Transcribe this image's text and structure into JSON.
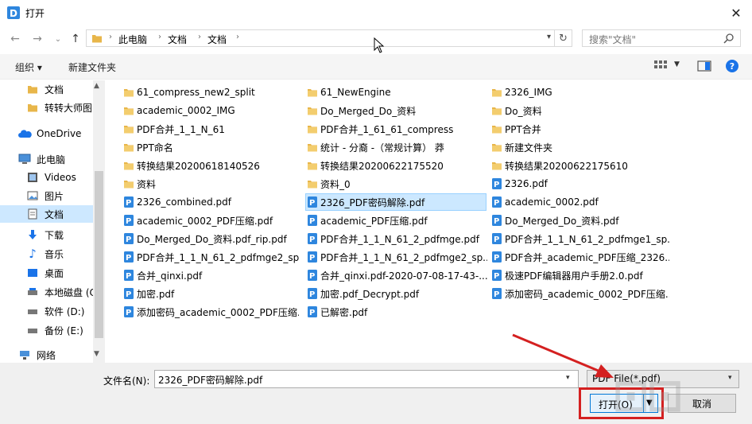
{
  "window": {
    "title": "打开"
  },
  "address": {
    "breadcrumb": [
      "此电脑",
      "文档",
      "文档"
    ]
  },
  "search": {
    "placeholder": "搜索\"文档\""
  },
  "toolbar": {
    "organize": "组织 ▾",
    "new_folder": "新建文件夹"
  },
  "sidebar": {
    "items": [
      {
        "label": "文档",
        "icon": "folder-icon"
      },
      {
        "label": "转转大师图",
        "icon": "folder-icon"
      },
      {
        "label": "OneDrive",
        "icon": "cloud-icon"
      },
      {
        "label": "此电脑",
        "icon": "computer-icon"
      },
      {
        "label": "Videos",
        "icon": "video-icon"
      },
      {
        "label": "图片",
        "icon": "picture-icon"
      },
      {
        "label": "文档",
        "icon": "document-icon"
      },
      {
        "label": "下载",
        "icon": "download-icon"
      },
      {
        "label": "音乐",
        "icon": "music-icon"
      },
      {
        "label": "桌面",
        "icon": "desktop-icon"
      },
      {
        "label": "本地磁盘 (C",
        "icon": "drive-icon"
      },
      {
        "label": "软件 (D:)",
        "icon": "drive-icon"
      },
      {
        "label": "备份 (E:)",
        "icon": "drive-icon"
      },
      {
        "label": "网络",
        "icon": "network-icon"
      }
    ]
  },
  "files": [
    {
      "name": "61_compress_new2_split",
      "type": "folder"
    },
    {
      "name": "academic_0002_IMG",
      "type": "folder"
    },
    {
      "name": "PDF合并_1_1_N_61",
      "type": "folder"
    },
    {
      "name": "PPT命名",
      "type": "folder"
    },
    {
      "name": "转换结果20200618140526",
      "type": "folder"
    },
    {
      "name": "资料",
      "type": "folder"
    },
    {
      "name": "2326_combined.pdf",
      "type": "pdf"
    },
    {
      "name": "academic_0002_PDF压缩.pdf",
      "type": "pdf"
    },
    {
      "name": "Do_Merged_Do_资料.pdf_rip.pdf",
      "type": "pdf"
    },
    {
      "name": "PDF合并_1_1_N_61_2_pdfmge2_sp...",
      "type": "pdf"
    },
    {
      "name": "合并_qinxi.pdf",
      "type": "pdf"
    },
    {
      "name": "加密.pdf",
      "type": "pdf"
    },
    {
      "name": "添加密码_academic_0002_PDF压缩...",
      "type": "pdf"
    },
    {
      "name": "61_NewEngine",
      "type": "folder"
    },
    {
      "name": "Do_Merged_Do_资料",
      "type": "folder"
    },
    {
      "name": "PDF合并_1_61_61_compress",
      "type": "folder"
    },
    {
      "name": "统计 - 分裔 -（常规计算） 莽",
      "type": "folder"
    },
    {
      "name": "转换结果20200622175520",
      "type": "folder"
    },
    {
      "name": "资料_0",
      "type": "folder"
    },
    {
      "name": "2326_PDF密码解除.pdf",
      "type": "pdf",
      "selected": true
    },
    {
      "name": "academic_PDF压缩.pdf",
      "type": "pdf"
    },
    {
      "name": "PDF合并_1_1_N_61_2_pdfmge.pdf",
      "type": "pdf"
    },
    {
      "name": "PDF合并_1_1_N_61_2_pdfmge2_sp...",
      "type": "pdf"
    },
    {
      "name": "合并_qinxi.pdf-2020-07-08-17-43-...",
      "type": "pdf"
    },
    {
      "name": "加密.pdf_Decrypt.pdf",
      "type": "pdf"
    },
    {
      "name": "已解密.pdf",
      "type": "pdf"
    },
    {
      "name": "2326_IMG",
      "type": "folder"
    },
    {
      "name": "Do_资料",
      "type": "folder"
    },
    {
      "name": "PPT合并",
      "type": "folder"
    },
    {
      "name": "新建文件夹",
      "type": "folder"
    },
    {
      "name": "转换结果20200622175610",
      "type": "folder"
    },
    {
      "name": "2326.pdf",
      "type": "pdf"
    },
    {
      "name": "academic_0002.pdf",
      "type": "pdf"
    },
    {
      "name": "Do_Merged_Do_资料.pdf",
      "type": "pdf"
    },
    {
      "name": "PDF合并_1_1_N_61_2_pdfmge1_sp...",
      "type": "pdf"
    },
    {
      "name": "PDF合并_academic_PDF压缩_2326....",
      "type": "pdf"
    },
    {
      "name": "极速PDF编辑器用户手册2.0.pdf",
      "type": "pdf"
    },
    {
      "name": "添加密码_academic_0002_PDF压缩...",
      "type": "pdf"
    }
  ],
  "bottom": {
    "filename_label": "文件名(N):",
    "filename_value": "2326_PDF密码解除.pdf",
    "filter": "PDF File(*.pdf)",
    "open_label": "打开(O)",
    "cancel_label": "取消"
  },
  "colors": {
    "accent": "#0078d7",
    "folder": "#e8b64a",
    "pdf": "#2e86de",
    "annotation": "#d42020"
  }
}
